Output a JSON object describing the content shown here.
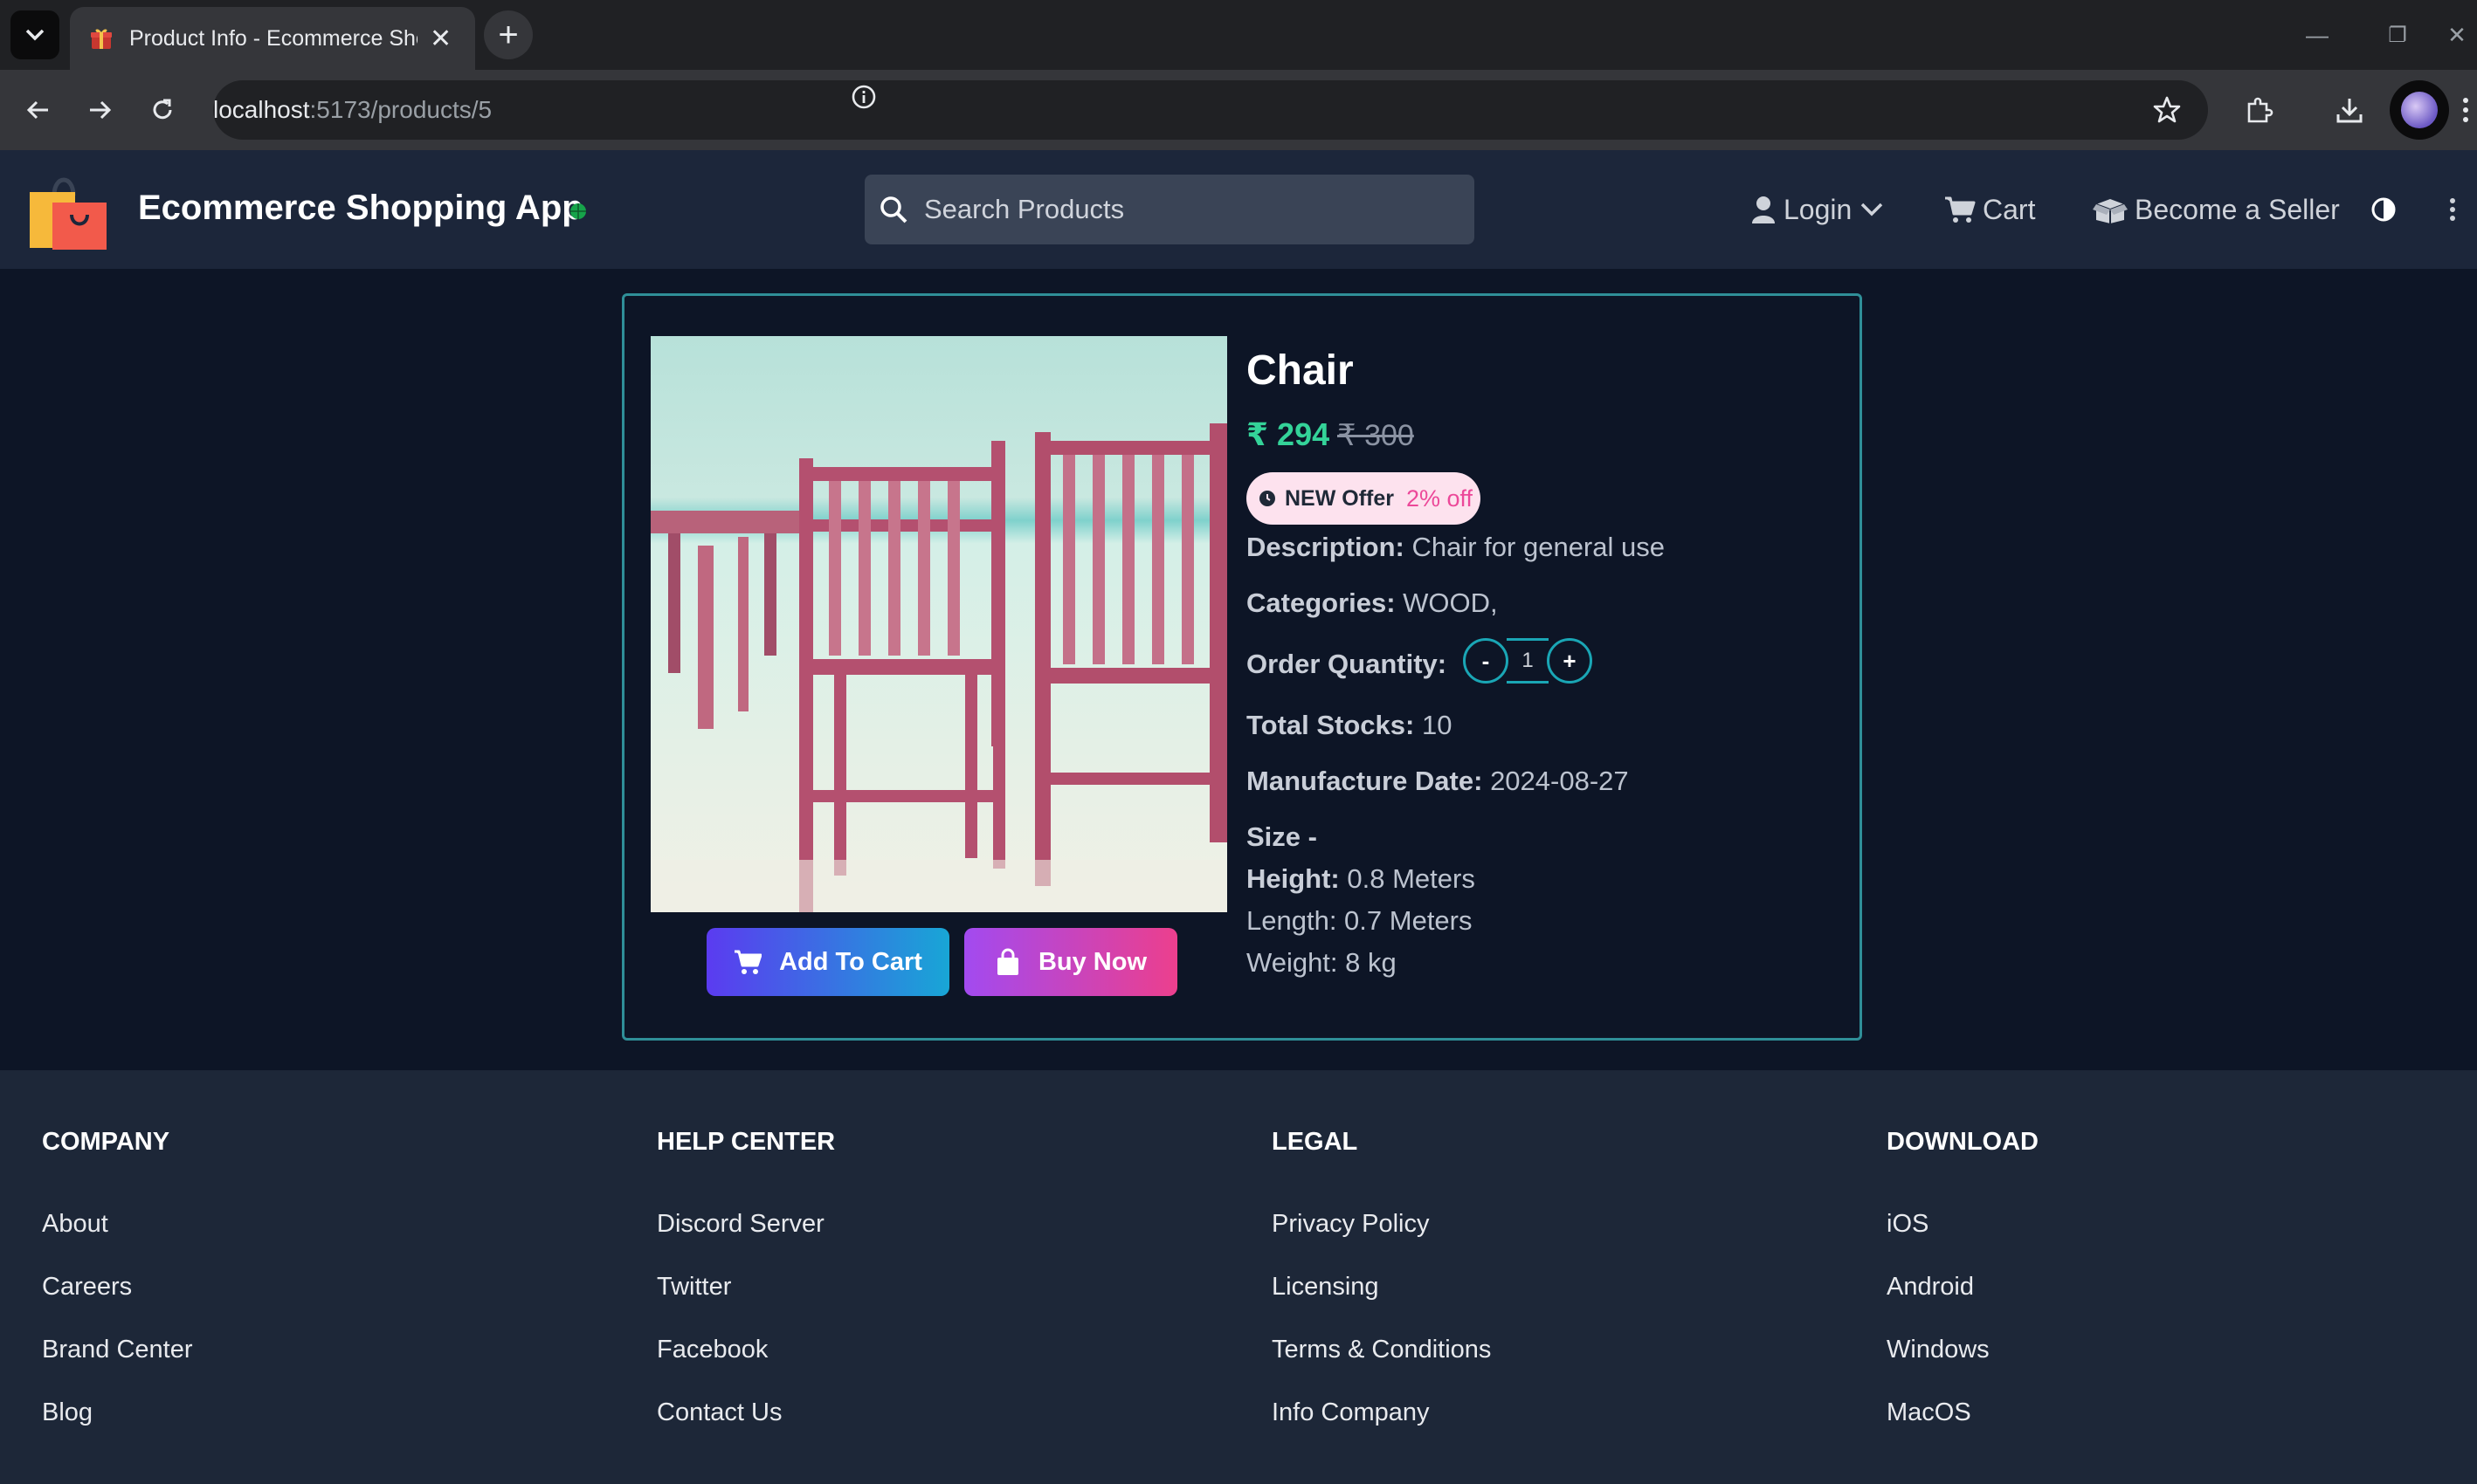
{
  "browser": {
    "tab_title": "Product Info - Ecommerce Shop",
    "url_host": "localhost",
    "url_path": ":5173/products/5"
  },
  "header": {
    "brand": "Ecommerce Shopping App",
    "search_placeholder": "Search Products",
    "login_label": "Login",
    "cart_label": "Cart",
    "seller_label": "Become a Seller"
  },
  "product": {
    "name": "Chair",
    "price": "₹ 294",
    "mrp": "₹ 300",
    "offer_label": "NEW Offer",
    "discount": "2% off",
    "description_label": "Description:",
    "description": "Chair for general use",
    "categories_label": "Categories:",
    "categories": "WOOD,",
    "quantity_label": "Order Quantity:",
    "quantity": "1",
    "decrement_label": "-",
    "increment_label": "+",
    "stock_label": "Total Stocks:",
    "stock": "10",
    "mfg_label": "Manufacture Date:",
    "mfg_date": "2024-08-27",
    "size_label": "Size -",
    "height_label": "Height:",
    "height": "0.8 Meters",
    "length": "Length: 0.7 Meters",
    "weight": "Weight: 8 kg",
    "add_to_cart": "Add To Cart",
    "buy_now": "Buy Now"
  },
  "footer": {
    "columns": [
      {
        "heading": "COMPANY",
        "links": [
          "About",
          "Careers",
          "Brand Center",
          "Blog"
        ]
      },
      {
        "heading": "HELP CENTER",
        "links": [
          "Discord Server",
          "Twitter",
          "Facebook",
          "Contact Us"
        ]
      },
      {
        "heading": "LEGAL",
        "links": [
          "Privacy Policy",
          "Licensing",
          "Terms & Conditions",
          "Info Company"
        ]
      },
      {
        "heading": "DOWNLOAD",
        "links": [
          "iOS",
          "Android",
          "Windows",
          "MacOS"
        ]
      }
    ]
  },
  "colors": {
    "background": "#0d1526",
    "header": "#1c263a",
    "footer": "#1d2738",
    "card_border": "#2f8f98",
    "price": "#34d399",
    "discount": "#ec4899"
  },
  "icons": [
    "tab-search-icon",
    "gift-favicon-icon",
    "close-icon",
    "plus-icon",
    "back-icon",
    "forward-icon",
    "reload-icon",
    "info-icon",
    "star-icon",
    "extensions-icon",
    "download-icon",
    "shopping-bag-logo-icon",
    "search-icon",
    "user-icon",
    "chevron-down-icon",
    "cart-icon",
    "box-icon",
    "contrast-icon",
    "kebab-icon",
    "clock-icon",
    "bag-icon"
  ]
}
